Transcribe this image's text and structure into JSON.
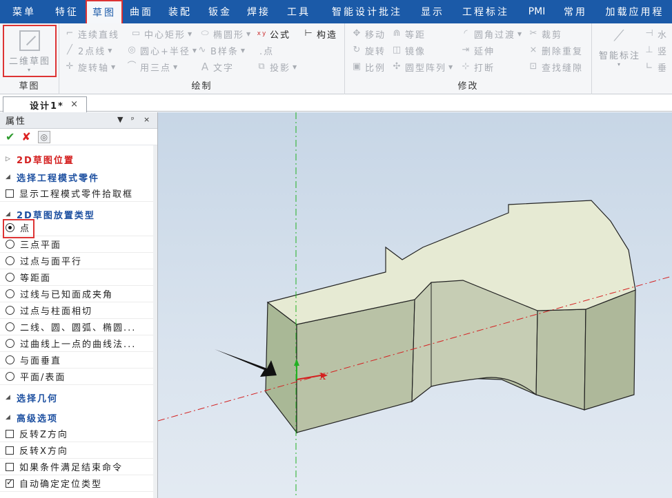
{
  "menubar": {
    "items": [
      "菜单",
      "特征",
      "草图",
      "曲面",
      "装配",
      "钣金",
      "焊接",
      "工具",
      "智能设计批注",
      "显示",
      "工程标注",
      "PMI",
      "常用",
      "加载应用程"
    ],
    "active": "草图"
  },
  "ribbon": {
    "sketch_group": {
      "big_button": "二维草图",
      "title": "草图"
    },
    "draw_group": {
      "title": "绘制",
      "buttons": [
        "连续直线",
        "中心矩形",
        "椭圆形",
        "公式",
        "构造",
        "2点线",
        "圆心+半径",
        "B样条",
        ".点",
        "旋转轴",
        "用三点",
        "文字",
        "投影"
      ]
    },
    "modify_group": {
      "title": "修改",
      "buttons": [
        "移动",
        "等距",
        "圆角过渡",
        "裁剪",
        "旋转",
        "镜像",
        "延伸",
        "删除重复",
        "比例",
        "圆型阵列",
        "打断",
        "查找缝隙"
      ]
    },
    "annot_group": {
      "big_button": "智能标注",
      "buttons": [
        "水",
        "竖",
        "垂"
      ]
    }
  },
  "doc_tab": {
    "label": "设计1*",
    "close": "×"
  },
  "panel": {
    "title": "属性",
    "header_controls": [
      "▼",
      "ᵖ",
      "×"
    ],
    "rows": [
      {
        "type": "section",
        "label": "2D草图位置",
        "arrow": "▷",
        "color": "red"
      },
      {
        "type": "section",
        "label": "选择工程模式零件",
        "arrow": "◢"
      },
      {
        "type": "check",
        "label": "显示工程模式零件拾取框",
        "checked": false
      },
      {
        "type": "section",
        "label": "2D草图放置类型",
        "arrow": "◢"
      },
      {
        "type": "radio",
        "label": "点",
        "selected": true
      },
      {
        "type": "radio",
        "label": "三点平面",
        "selected": false
      },
      {
        "type": "radio",
        "label": "过点与面平行",
        "selected": false
      },
      {
        "type": "radio",
        "label": "等距面",
        "selected": false
      },
      {
        "type": "radio",
        "label": "过线与已知面成夹角",
        "selected": false
      },
      {
        "type": "radio",
        "label": "过点与柱面相切",
        "selected": false
      },
      {
        "type": "radio",
        "label": "二线、圆、圆弧、椭圆...",
        "selected": false
      },
      {
        "type": "radio",
        "label": "过曲线上一点的曲线法...",
        "selected": false
      },
      {
        "type": "radio",
        "label": "与面垂直",
        "selected": false
      },
      {
        "type": "radio",
        "label": "平面/表面",
        "selected": false
      },
      {
        "type": "section",
        "label": "选择几何",
        "arrow": "◢"
      },
      {
        "type": "section",
        "label": "高级选项",
        "arrow": "◢"
      },
      {
        "type": "check",
        "label": "反转Z方向",
        "checked": false
      },
      {
        "type": "check",
        "label": "反转X方向",
        "checked": false
      },
      {
        "type": "check",
        "label": "如果条件满足结束命令",
        "checked": false
      },
      {
        "type": "check",
        "label": "自动确定定位类型",
        "checked": true
      }
    ]
  },
  "viewport": {
    "axis_label": "X"
  }
}
